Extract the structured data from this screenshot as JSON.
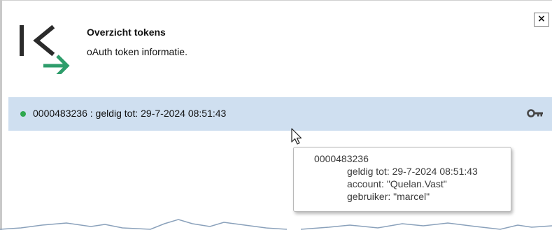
{
  "dialog": {
    "close_label": "×",
    "title": "Overzicht tokens",
    "subtitle": "oAuth token informatie."
  },
  "token": {
    "text": "0000483236 : geldig tot: 29-7-2024 08:51:43",
    "status_color": "#2fa84f",
    "icon": "key-icon"
  },
  "tooltip": {
    "id": "0000483236",
    "valid_until": "geldig tot: 29-7-2024 08:51:43",
    "account": "account: \"Quelan.Vast\"",
    "user": "gebruiker: \"marcel\""
  },
  "colors": {
    "selection": "#cfdff0",
    "logo_dark": "#2b2b2b",
    "logo_green": "#2e9d6b"
  }
}
